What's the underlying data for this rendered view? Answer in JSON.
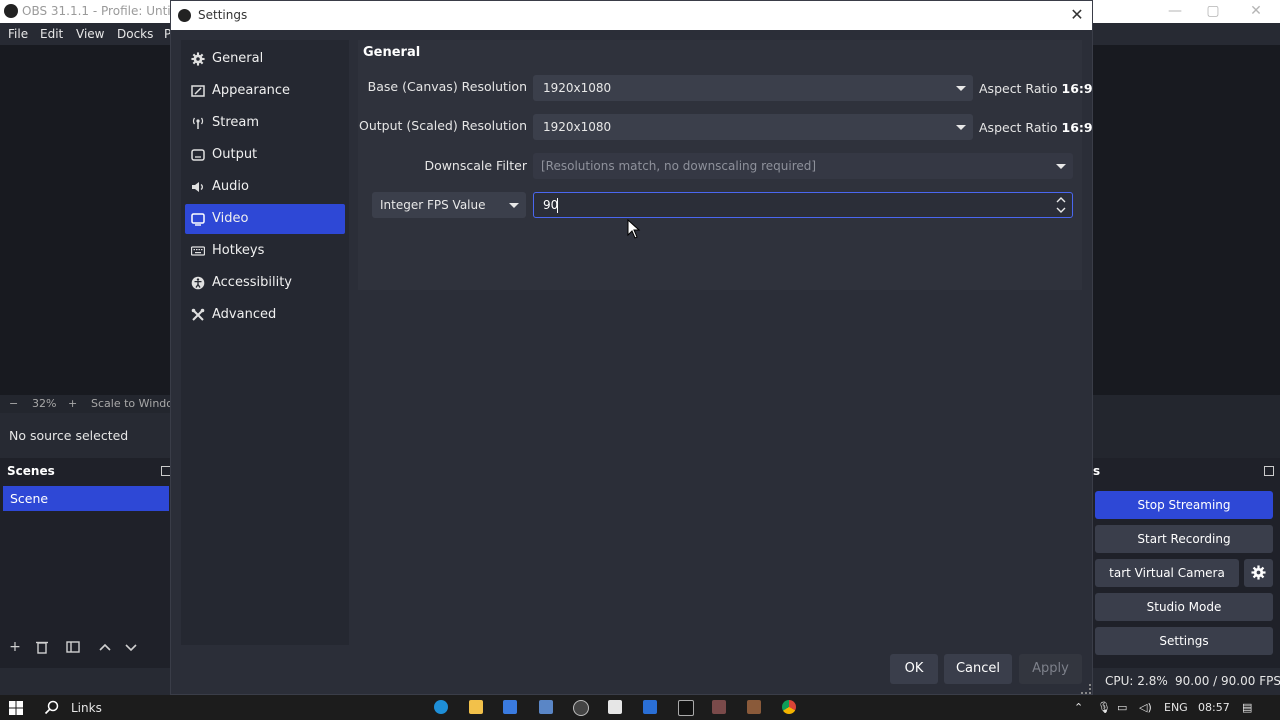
{
  "main_window": {
    "title": "OBS 31.1.1 - Profile: Untitled -",
    "menu": [
      "File",
      "Edit",
      "View",
      "Docks",
      "P"
    ],
    "zoom": {
      "minus": "−",
      "value": "32%",
      "plus": "+",
      "mode": "Scale to Window"
    },
    "source_status": "No source selected",
    "scenes_title": "Scenes",
    "scenes": [
      "Scene"
    ],
    "controls_title": "s",
    "controls": {
      "stop_streaming": "Stop Streaming",
      "start_recording": "Start Recording",
      "start_virtual_camera": "tart Virtual Camera",
      "studio_mode": "Studio Mode",
      "settings": "Settings"
    },
    "status": {
      "cpu": "CPU: 2.8%",
      "fps": "90.00 / 90.00 FPS"
    }
  },
  "taskbar": {
    "search_label": "Links",
    "language": "ENG",
    "time": "08:57"
  },
  "dialog": {
    "title": "Settings",
    "nav": [
      {
        "label": "General",
        "icon": "gear-icon"
      },
      {
        "label": "Appearance",
        "icon": "palette-icon"
      },
      {
        "label": "Stream",
        "icon": "broadcast-icon"
      },
      {
        "label": "Output",
        "icon": "output-icon"
      },
      {
        "label": "Audio",
        "icon": "speaker-icon"
      },
      {
        "label": "Video",
        "icon": "monitor-icon",
        "active": true
      },
      {
        "label": "Hotkeys",
        "icon": "keyboard-icon"
      },
      {
        "label": "Accessibility",
        "icon": "accessibility-icon"
      },
      {
        "label": "Advanced",
        "icon": "tools-icon"
      }
    ],
    "section_title": "General",
    "base_resolution": {
      "label": "Base (Canvas) Resolution",
      "value": "1920x1080",
      "aspect_prefix": "Aspect Ratio",
      "aspect_value": "16:9"
    },
    "output_resolution": {
      "label": "Output (Scaled) Resolution",
      "value": "1920x1080",
      "aspect_prefix": "Aspect Ratio",
      "aspect_value": "16:9"
    },
    "downscale_filter": {
      "label": "Downscale Filter",
      "value": "[Resolutions match, no downscaling required]"
    },
    "fps": {
      "type_value": "Integer FPS Value",
      "value": "90"
    },
    "buttons": {
      "ok": "OK",
      "cancel": "Cancel",
      "apply": "Apply"
    }
  },
  "colors": {
    "accent": "#2e48d6",
    "dialog_bg": "#2b2e38",
    "input_focus": "#4a67f0"
  }
}
